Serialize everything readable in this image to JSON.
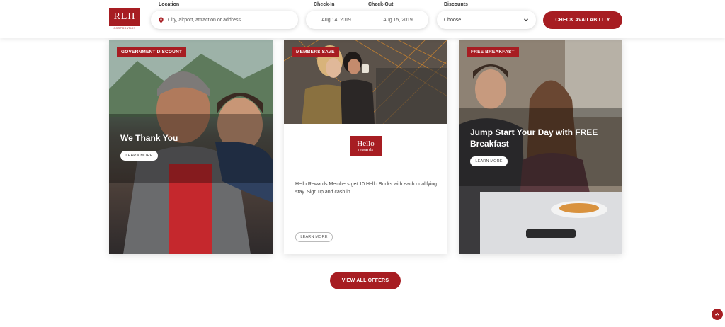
{
  "brand": {
    "logo_text": "RLH",
    "logo_sub": "CORPORATION",
    "color": "#a71d22"
  },
  "search": {
    "location_label": "Location",
    "location_placeholder": "City, airport, attraction or address",
    "checkin_label": "Check-In",
    "checkout_label": "Check-Out",
    "checkin_value": "Aug 14, 2019",
    "checkout_value": "Aug 15, 2019",
    "discounts_label": "Discounts",
    "discounts_value": "Choose",
    "submit_label": "CHECK AVAILABILITY"
  },
  "offers": [
    {
      "badge": "GOVERNMENT DISCOUNT",
      "title": "We Thank You",
      "button": "LEARN MORE"
    },
    {
      "badge": "MEMBERS SAVE",
      "logo_line1": "Hello",
      "logo_line2": "rewards",
      "text": "Hello Rewards Members get 10 Hello Bucks with each qualifying stay. Sign up and cash in.",
      "button": "LEARN MORE"
    },
    {
      "badge": "FREE BREAKFAST",
      "title": "Jump Start Your Day with FREE Breakfast",
      "button": "LEARN MORE"
    }
  ],
  "view_all_label": "VIEW ALL OFFERS",
  "icons": {
    "location": "map-pin-icon",
    "dropdown": "chevron-down-icon",
    "back_to_top": "chevron-up-icon"
  }
}
